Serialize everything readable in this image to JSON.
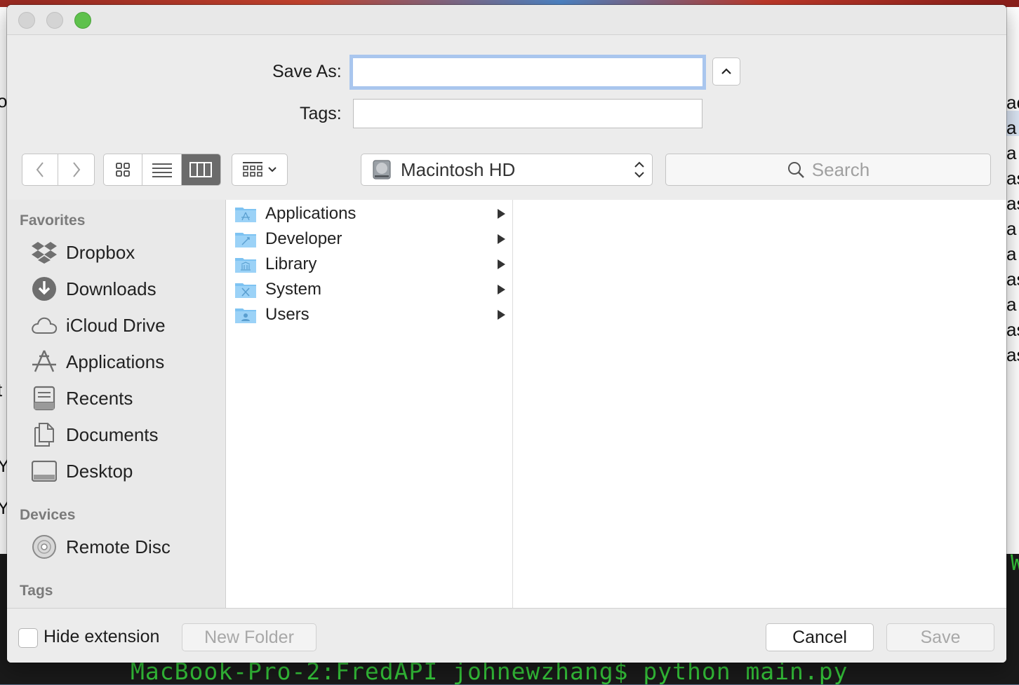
{
  "background": {
    "terminal_text": "MacBook-Pro-2:FredAPI johnewzhang$ python main.py",
    "right_edge_fragments": [
      "ac",
      "a",
      "a",
      "as",
      "as",
      "a",
      "a",
      "as",
      "a",
      "as",
      "as"
    ],
    "left_edge_fragments": [
      "o_",
      "t",
      "Y'",
      "Y"
    ],
    "bottom_right_fragment": "W"
  },
  "form": {
    "save_as_label": "Save As:",
    "save_as_value": "",
    "tags_label": "Tags:",
    "tags_value": ""
  },
  "toolbar": {
    "location": "Macintosh HD",
    "search_placeholder": "Search",
    "active_view": "columns"
  },
  "sidebar": {
    "favorites_header": "Favorites",
    "favorites": [
      {
        "label": "Dropbox",
        "icon": "dropbox-icon"
      },
      {
        "label": "Downloads",
        "icon": "downloads-icon"
      },
      {
        "label": "iCloud Drive",
        "icon": "cloud-icon"
      },
      {
        "label": "Applications",
        "icon": "applications-icon"
      },
      {
        "label": "Recents",
        "icon": "recents-icon"
      },
      {
        "label": "Documents",
        "icon": "documents-icon"
      },
      {
        "label": "Desktop",
        "icon": "desktop-icon"
      }
    ],
    "devices_header": "Devices",
    "devices": [
      {
        "label": "Remote Disc",
        "icon": "disc-icon"
      }
    ],
    "tags_header": "Tags"
  },
  "files": [
    {
      "name": "Applications",
      "icon": "applications-folder-icon"
    },
    {
      "name": "Developer",
      "icon": "developer-folder-icon"
    },
    {
      "name": "Library",
      "icon": "library-folder-icon"
    },
    {
      "name": "System",
      "icon": "system-folder-icon"
    },
    {
      "name": "Users",
      "icon": "users-folder-icon"
    }
  ],
  "footer": {
    "hide_extension_label": "Hide extension",
    "hide_extension_checked": false,
    "new_folder_label": "New Folder",
    "cancel_label": "Cancel",
    "save_label": "Save"
  },
  "colors": {
    "folder_blue": "#7ec3f2",
    "focus_ring": "#a9c6ee",
    "terminal_green": "#35c53a"
  }
}
